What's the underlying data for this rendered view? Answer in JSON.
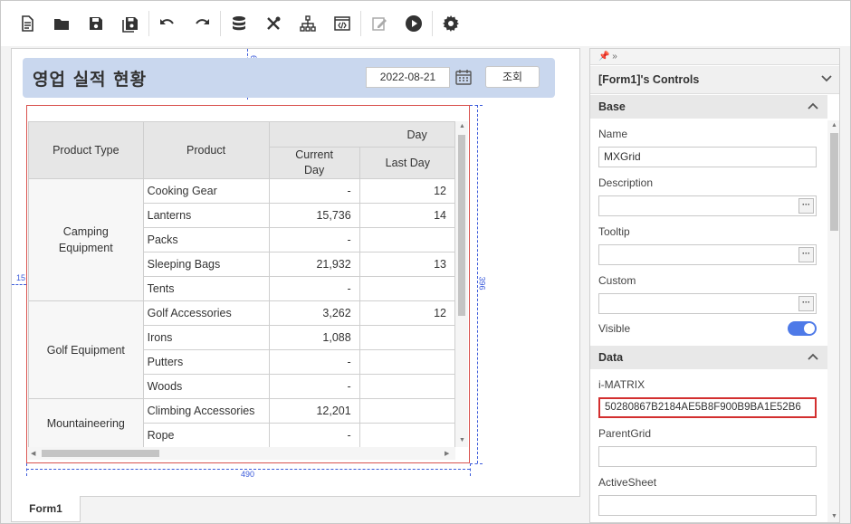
{
  "toolbar": {
    "items": [
      "new-file-icon",
      "open-folder-icon",
      "save-icon",
      "save-all-icon",
      "undo-icon",
      "redo-icon",
      "database-icon",
      "tools-icon",
      "hierarchy-icon",
      "code-icon",
      "edit-icon",
      "play-icon",
      "gear-icon"
    ]
  },
  "form": {
    "title": "영업 실적 현황",
    "date": "2022-08-21",
    "search_label": "조회",
    "dims": {
      "top_gap": "62",
      "left_gap": "15",
      "width": "490",
      "height": "396"
    }
  },
  "grid": {
    "headers": {
      "product_type": "Product Type",
      "product": "Product",
      "day": "Day",
      "current_day": "Current\nDay",
      "last_day": "Last Day"
    },
    "rows": [
      {
        "category": "Camping\nEquipment",
        "span": 5,
        "product": "Cooking Gear",
        "current": "-",
        "last": "12"
      },
      {
        "product": "Lanterns",
        "current": "15,736",
        "last": "14"
      },
      {
        "product": "Packs",
        "current": "-",
        "last": ""
      },
      {
        "product": "Sleeping Bags",
        "current": "21,932",
        "last": "13"
      },
      {
        "product": "Tents",
        "current": "-",
        "last": ""
      },
      {
        "category": "Golf Equipment",
        "span": 4,
        "product": "Golf Accessories",
        "current": "3,262",
        "last": "12"
      },
      {
        "product": "Irons",
        "current": "1,088",
        "last": ""
      },
      {
        "product": "Putters",
        "current": "-",
        "last": ""
      },
      {
        "product": "Woods",
        "current": "-",
        "last": ""
      },
      {
        "category": "Mountaineering",
        "span": 2,
        "product": "Climbing Accessories",
        "current": "12,201",
        "last": ""
      },
      {
        "product": "Rope",
        "current": "-",
        "last": ""
      }
    ]
  },
  "tabs": {
    "form1": "Form1"
  },
  "panel": {
    "title": "[Form1]'s Controls",
    "base_section": "Base",
    "name_label": "Name",
    "name_value": "MXGrid",
    "description_label": "Description",
    "tooltip_label": "Tooltip",
    "custom_label": "Custom",
    "visible_label": "Visible",
    "data_section": "Data",
    "imatrix_label": "i-MATRIX",
    "imatrix_value": "50280867B2184AE5B8F900B9BA1E52B6",
    "parentgrid_label": "ParentGrid",
    "activesheet_label": "ActiveSheet"
  },
  "colors": {
    "accent": "#4e7ae8",
    "header_band": "#c9d7ee",
    "selection": "#d32f2f"
  }
}
